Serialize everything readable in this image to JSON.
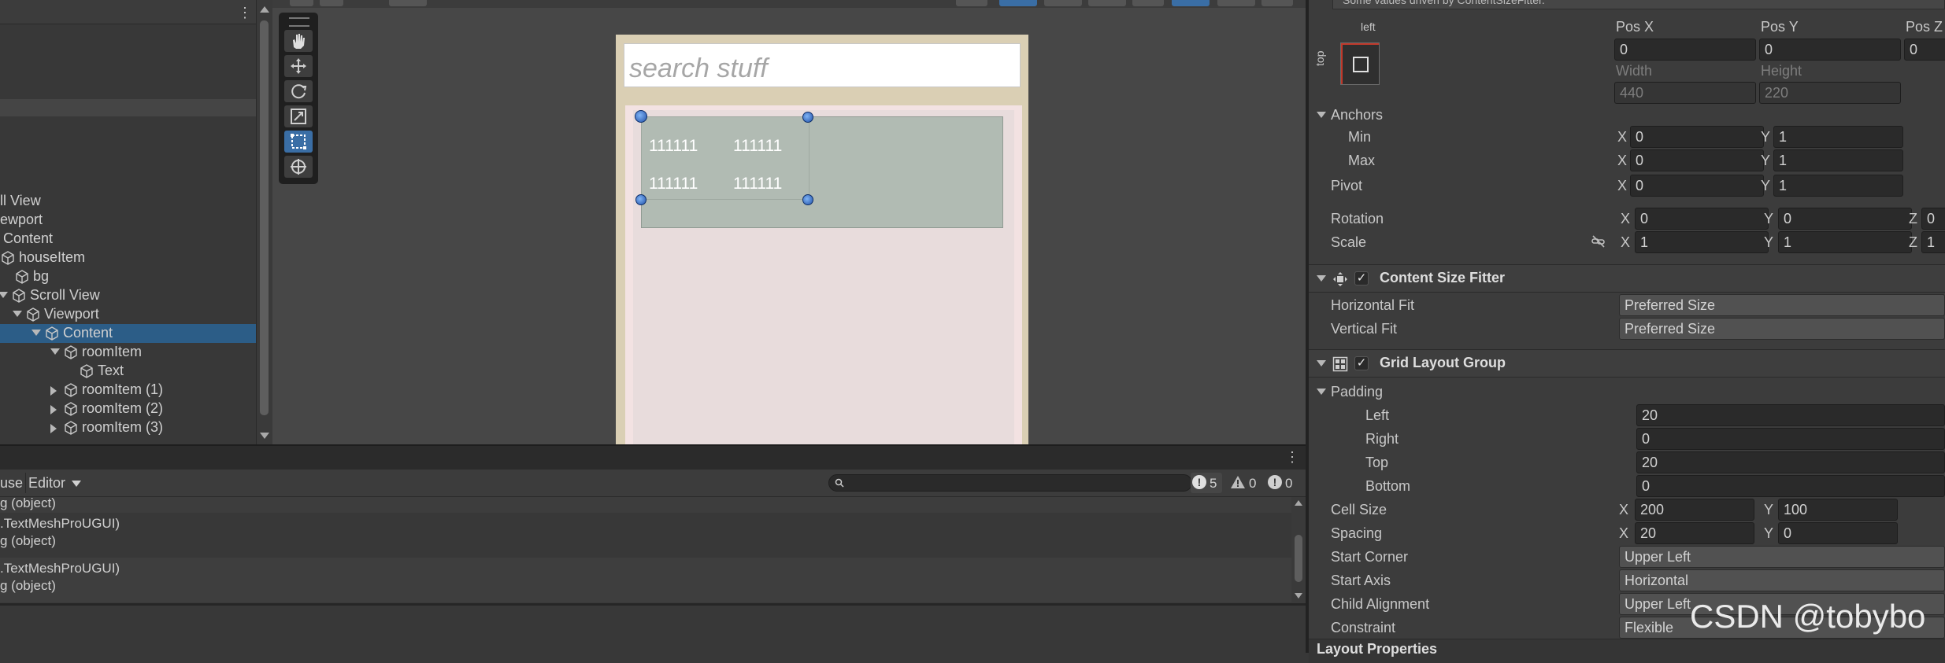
{
  "hierarchy": {
    "rows": [
      {
        "label": "ll View",
        "indent": 0,
        "icon": false,
        "arrow": "none"
      },
      {
        "label": "ewport",
        "indent": 0,
        "icon": false,
        "arrow": "none"
      },
      {
        "label": "Content",
        "indent": 4,
        "icon": false,
        "arrow": "none"
      },
      {
        "label": "houseItem",
        "indent": 0,
        "icon": true,
        "arrow": "none"
      },
      {
        "label": "bg",
        "indent": 18,
        "icon": true,
        "arrow": "none"
      },
      {
        "label": "Scroll View",
        "indent": 0,
        "icon": true,
        "arrow": "down"
      },
      {
        "label": "Viewport",
        "indent": 18,
        "icon": true,
        "arrow": "down"
      },
      {
        "label": "Content",
        "indent": 42,
        "icon": true,
        "arrow": "down",
        "selected": true
      },
      {
        "label": "roomItem",
        "indent": 66,
        "icon": true,
        "arrow": "down"
      },
      {
        "label": "Text",
        "indent": 100,
        "icon": true,
        "arrow": "none"
      },
      {
        "label": "roomItem (1)",
        "indent": 66,
        "icon": true,
        "arrow": "right"
      },
      {
        "label": "roomItem (2)",
        "indent": 66,
        "icon": true,
        "arrow": "right"
      },
      {
        "label": "roomItem (3)",
        "indent": 66,
        "icon": true,
        "arrow": "right"
      }
    ]
  },
  "tools": [
    "view-tool-icon",
    "move-tool-icon",
    "rotate-tool-icon",
    "scale-tool-icon",
    "rect-tool-icon",
    "transform-tool-icon"
  ],
  "scene": {
    "search_placeholder": "search stuff",
    "cells": [
      "111111",
      "111111",
      "111111",
      "111111"
    ]
  },
  "console": {
    "tab_partial": "use",
    "editor_label": "Editor",
    "counts": {
      "errors": "5",
      "warnings": "0",
      "infos": "0"
    },
    "lines": [
      "g (object)",
      ".TextMeshProUGUI)",
      "g (object)",
      ".TextMeshProUGUI)",
      "g (object)"
    ]
  },
  "inspector": {
    "notice": "Some values driven by ContentSizeFitter.",
    "anchor_preset": {
      "left": "left",
      "top": "top"
    },
    "pos": {
      "labels": [
        "Pos X",
        "Pos Y",
        "Pos Z"
      ],
      "values": [
        "0",
        "0",
        "0"
      ],
      "size_labels": [
        "Width",
        "Height"
      ],
      "size_values": [
        "440",
        "220"
      ]
    },
    "anchors": {
      "title": "Anchors",
      "min_label": "Min",
      "min_x": "0",
      "min_y": "1",
      "max_label": "Max",
      "max_x": "0",
      "max_y": "1"
    },
    "pivot": {
      "label": "Pivot",
      "x": "0",
      "y": "1"
    },
    "rotation": {
      "label": "Rotation",
      "x": "0",
      "y": "0",
      "z": "0"
    },
    "scale": {
      "label": "Scale",
      "x": "1",
      "y": "1",
      "z": "1"
    },
    "axes": {
      "x": "X",
      "y": "Y",
      "z": "Z"
    },
    "csf": {
      "title": "Content Size Fitter",
      "h_label": "Horizontal Fit",
      "h_value": "Preferred Size",
      "v_label": "Vertical Fit",
      "v_value": "Preferred Size"
    },
    "grid": {
      "title": "Grid Layout Group",
      "padding_label": "Padding",
      "left_label": "Left",
      "left": "20",
      "right_label": "Right",
      "right": "0",
      "top_label": "Top",
      "top": "20",
      "bottom_label": "Bottom",
      "bottom": "0",
      "cell_size_label": "Cell Size",
      "cell_x": "200",
      "cell_y": "100",
      "spacing_label": "Spacing",
      "spacing_x": "20",
      "spacing_y": "0",
      "start_corner_label": "Start Corner",
      "start_corner": "Upper Left",
      "start_axis_label": "Start Axis",
      "start_axis": "Horizontal",
      "child_align_label": "Child Alignment",
      "child_align": "Upper Left",
      "constraint_label": "Constraint",
      "constraint": "Flexible"
    },
    "layout_props": "Layout Properties"
  },
  "watermark": "CSDN @tobybo",
  "colors": {
    "selection": "#2c5d87",
    "tool_active": "#3a6ea5",
    "scene_bg": "#474747",
    "panel_bg": "#383838",
    "inspector_bg": "#3c3c3c"
  }
}
